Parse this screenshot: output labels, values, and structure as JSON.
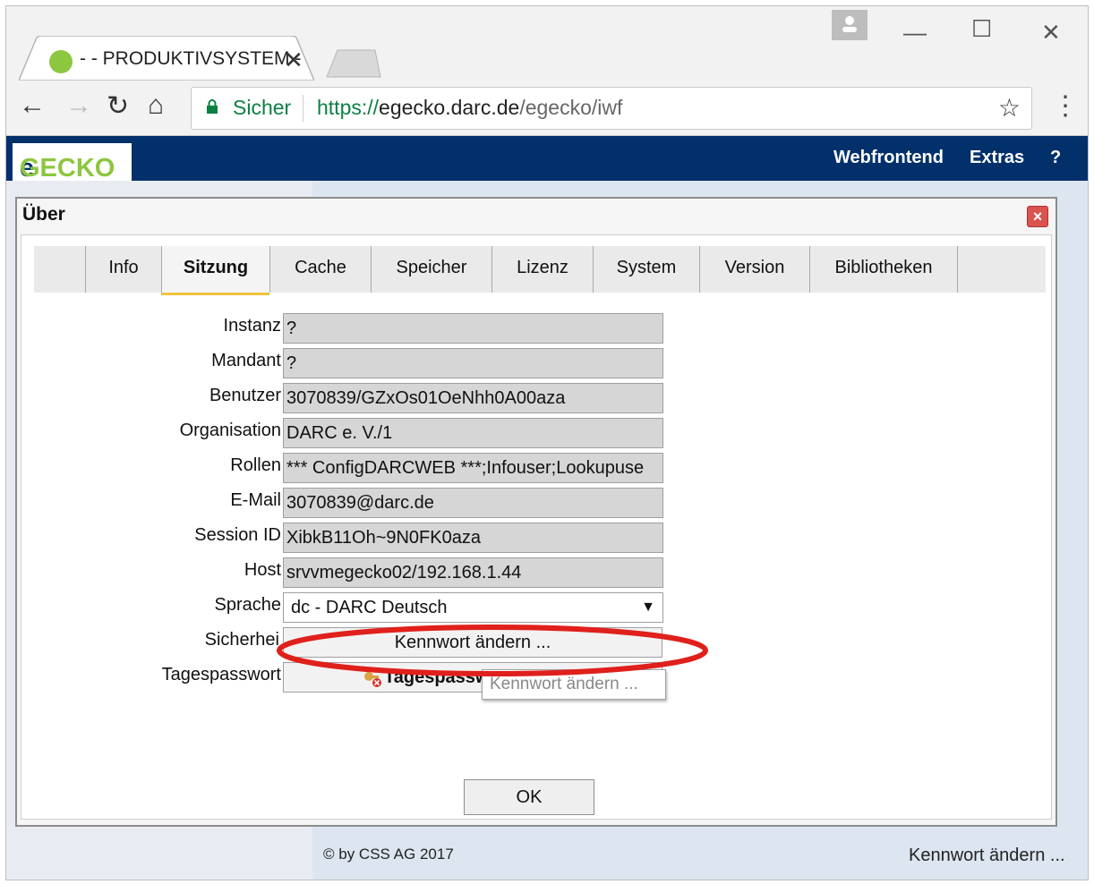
{
  "browser": {
    "tab_title": "- - PRODUKTIVSYSTEM -",
    "secure_label": "Sicher",
    "url_scheme": "https://",
    "url_host": "egecko.darc.de",
    "url_path": "/egecko/iwf"
  },
  "app": {
    "logo_e": "e",
    "logo_rest": "GECKO",
    "menu": [
      "Webfrontend",
      "Extras",
      "?"
    ],
    "footer": "© by CSS AG 2017",
    "footer_right": "Kennwort ändern ..."
  },
  "dialog": {
    "title": "Über",
    "tabs": [
      "Info",
      "Sitzung",
      "Cache",
      "Speicher",
      "Lizenz",
      "System",
      "Version",
      "Bibliotheken"
    ],
    "active_tab": "Sitzung",
    "fields": [
      {
        "label": "Instanz",
        "value": "?"
      },
      {
        "label": "Mandant",
        "value": "?"
      },
      {
        "label": "Benutzer",
        "value": "3070839/GZxOs01OeNhh0A00aza"
      },
      {
        "label": "Organisation",
        "value": "DARC e. V./1"
      },
      {
        "label": "Rollen",
        "value": "*** ConfigDARCWEB ***;Infouser;Lookupuse"
      },
      {
        "label": "E-Mail",
        "value": "3070839@darc.de"
      },
      {
        "label": "Session ID",
        "value": "XibkB11Oh~9N0FK0aza"
      },
      {
        "label": "Host",
        "value": "srvvmegecko02/192.168.1.44"
      }
    ],
    "sprache_label": "Sprache",
    "sprache_value": "dc - DARC Deutsch",
    "sicherheit_label": "Sicherhei",
    "kennwort_button": "Kennwort ändern ...",
    "tagespasswort_label": "Tagespasswort",
    "tagespasswort_button": "Tagespassw",
    "tooltip": "Kennwort ändern ...",
    "ok_label": "OK"
  },
  "colors": {
    "appbar": "#01306b",
    "logo_green": "#8dc63f",
    "highlight_ellipse": "#e0201b",
    "active_tab_underline": "#f0c43c"
  }
}
